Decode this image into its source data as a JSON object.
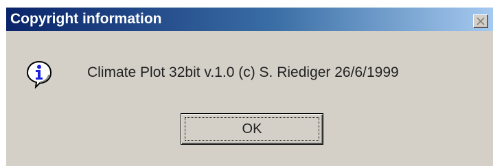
{
  "window": {
    "title": "Copyright information",
    "close_icon": "close-x-icon"
  },
  "content": {
    "icon": "info-icon",
    "message": "Climate Plot 32bit v.1.0 (c) S. Riediger 26/6/1999"
  },
  "buttons": {
    "ok_label": "OK"
  },
  "colors": {
    "title_start": "#0a246a",
    "title_end": "#a6caf0",
    "dialog_face": "#d4d0c8",
    "icon_blue": "#1e22e0"
  }
}
